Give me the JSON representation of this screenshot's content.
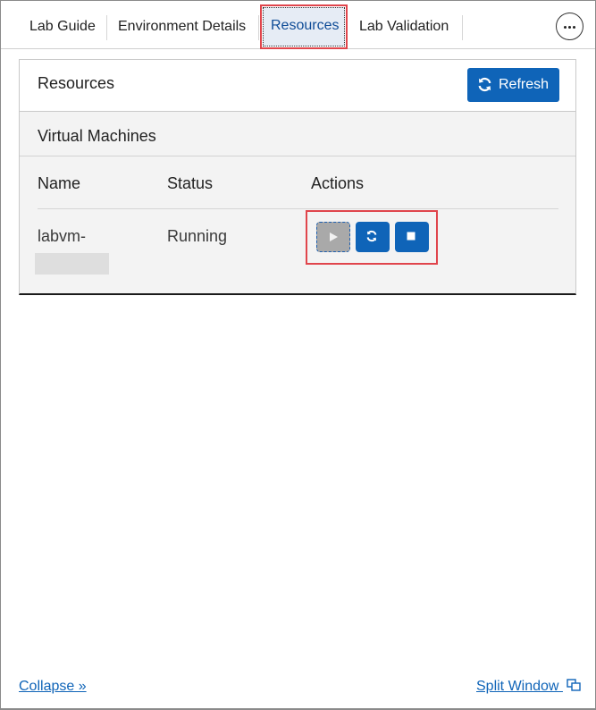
{
  "tabs": [
    {
      "label": "Lab Guide"
    },
    {
      "label": "Environment Details"
    },
    {
      "label": "Resources",
      "active": true
    },
    {
      "label": "Lab Validation"
    }
  ],
  "more": {
    "icon": "more-horizontal-icon"
  },
  "panel": {
    "title": "Resources",
    "refresh": {
      "label": "Refresh",
      "icon": "refresh-icon"
    },
    "section_title": "Virtual Machines",
    "columns": [
      "Name",
      "Status",
      "Actions"
    ],
    "rows": [
      {
        "name": "labvm-",
        "status": "Running",
        "actions": [
          {
            "icon": "play-icon",
            "enabled": false
          },
          {
            "icon": "restart-icon",
            "enabled": true
          },
          {
            "icon": "stop-icon",
            "enabled": true
          }
        ]
      }
    ]
  },
  "footer": {
    "collapse": "Collapse »",
    "split_window": "Split Window",
    "split_icon": "split-window-icon"
  },
  "colors": {
    "accent": "#0f64b8",
    "highlight": "#e0454c",
    "disabled": "#a9a9a9"
  }
}
